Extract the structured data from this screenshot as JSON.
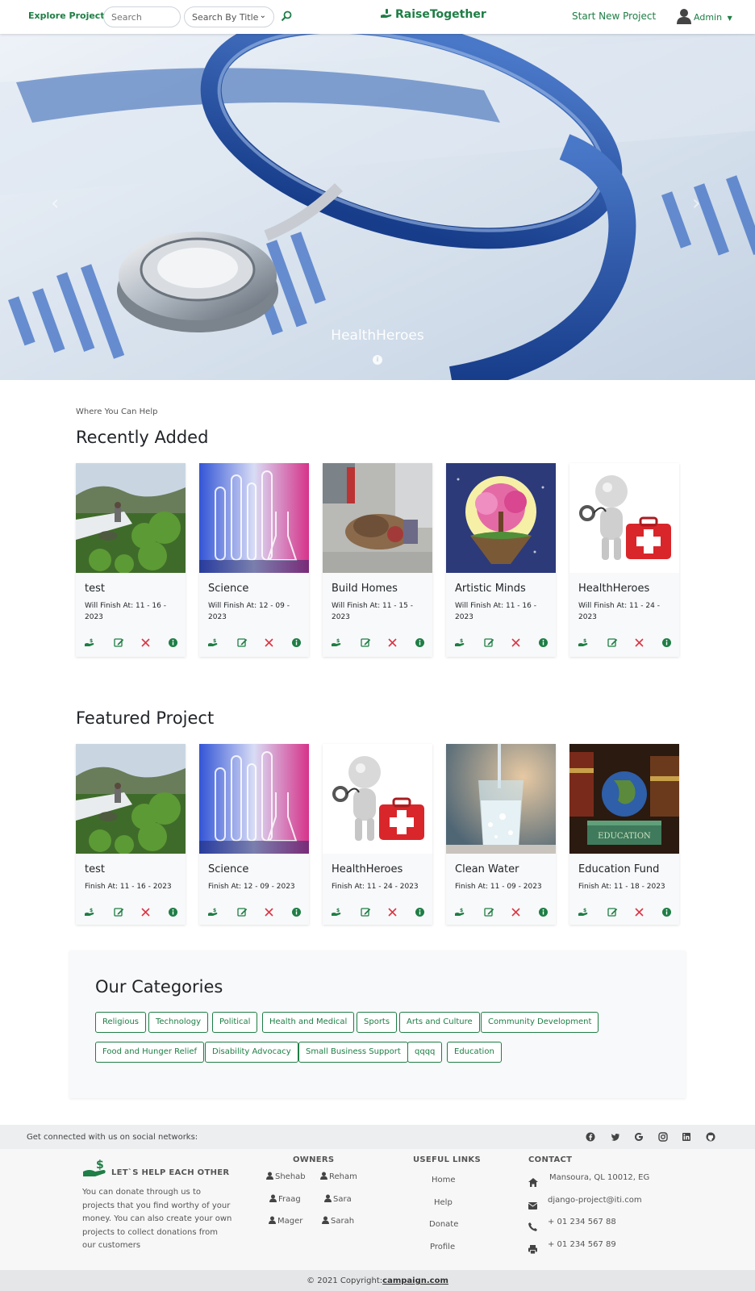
{
  "nav": {
    "explore": "Explore Projects",
    "search_placeholder": "Search",
    "search_by": "Search By Title",
    "brand": "RaiseTogether",
    "new_project": "Start New Project",
    "user": "Admin"
  },
  "hero": {
    "caption": "HealthHeroes"
  },
  "recent": {
    "eyebrow": "Where You Can Help",
    "title": "Recently Added",
    "cards": [
      {
        "title": "test",
        "finish": "Will Finish At: 11 - 16 - 2023"
      },
      {
        "title": "Science",
        "finish": "Will Finish At: 12 - 09 - 2023"
      },
      {
        "title": "Build Homes",
        "finish": "Will Finish At: 11 - 15 - 2023"
      },
      {
        "title": "Artistic Minds",
        "finish": "Will Finish At: 11 - 16 - 2023"
      },
      {
        "title": "HealthHeroes",
        "finish": "Will Finish At: 11 - 24 - 2023"
      }
    ]
  },
  "featured": {
    "title": "Featured Project",
    "cards": [
      {
        "title": "test",
        "finish": "Finish At: 11 - 16 - 2023"
      },
      {
        "title": "Science",
        "finish": "Finish At: 12 - 09 - 2023"
      },
      {
        "title": "HealthHeroes",
        "finish": "Finish At: 11 - 24 - 2023"
      },
      {
        "title": "Clean Water",
        "finish": "Finish At: 11 - 09 - 2023"
      },
      {
        "title": "Education Fund",
        "finish": "Finish At: 11 - 18 - 2023"
      }
    ]
  },
  "categories": {
    "title": "Our Categories",
    "items": [
      "Religious",
      "Technology",
      "Political",
      "Health and Medical",
      "Sports",
      "Arts and Culture",
      "Community Development",
      "Food and Hunger Relief",
      "Disability Advocacy",
      "Small Business Support",
      "qqqq",
      "Education"
    ]
  },
  "footer": {
    "social_text": "Get connected with us on social networks:",
    "about_title": "LET`S HELP EACH OTHER",
    "about_text": [
      "You can donate through us to",
      "projects that you find worthy of your",
      "money. You can also create your own",
      "projects to collect donations from",
      "our customers"
    ],
    "owners_title": "OWNERS",
    "owners": [
      "Shehab",
      "Reham",
      "Fraag",
      "Sara",
      "Mager",
      "Sarah"
    ],
    "links_title": "USEFUL LINKS",
    "links": [
      "Home",
      "Help",
      "Donate",
      "Profile"
    ],
    "contact_title": "CONTACT",
    "contact": [
      "Mansoura, QL 10012, EG",
      "django-project@iti.com",
      "+ 01 234 567 88",
      "+ 01 234 567 89"
    ],
    "copyright": "© 2021 Copyright:",
    "copyright_link": "campaign.com"
  },
  "colors": {
    "accent": "#1e7e45",
    "danger": "#dc3545"
  },
  "icons": [
    "search-icon",
    "hand-money-icon",
    "user-icon",
    "caret-down-icon",
    "donate-icon",
    "edit-icon",
    "delete-icon",
    "info-icon",
    "facebook-icon",
    "twitter-icon",
    "google-icon",
    "instagram-icon",
    "linkedin-icon",
    "github-icon",
    "home-icon",
    "envelope-icon",
    "phone-icon",
    "printer-icon"
  ]
}
